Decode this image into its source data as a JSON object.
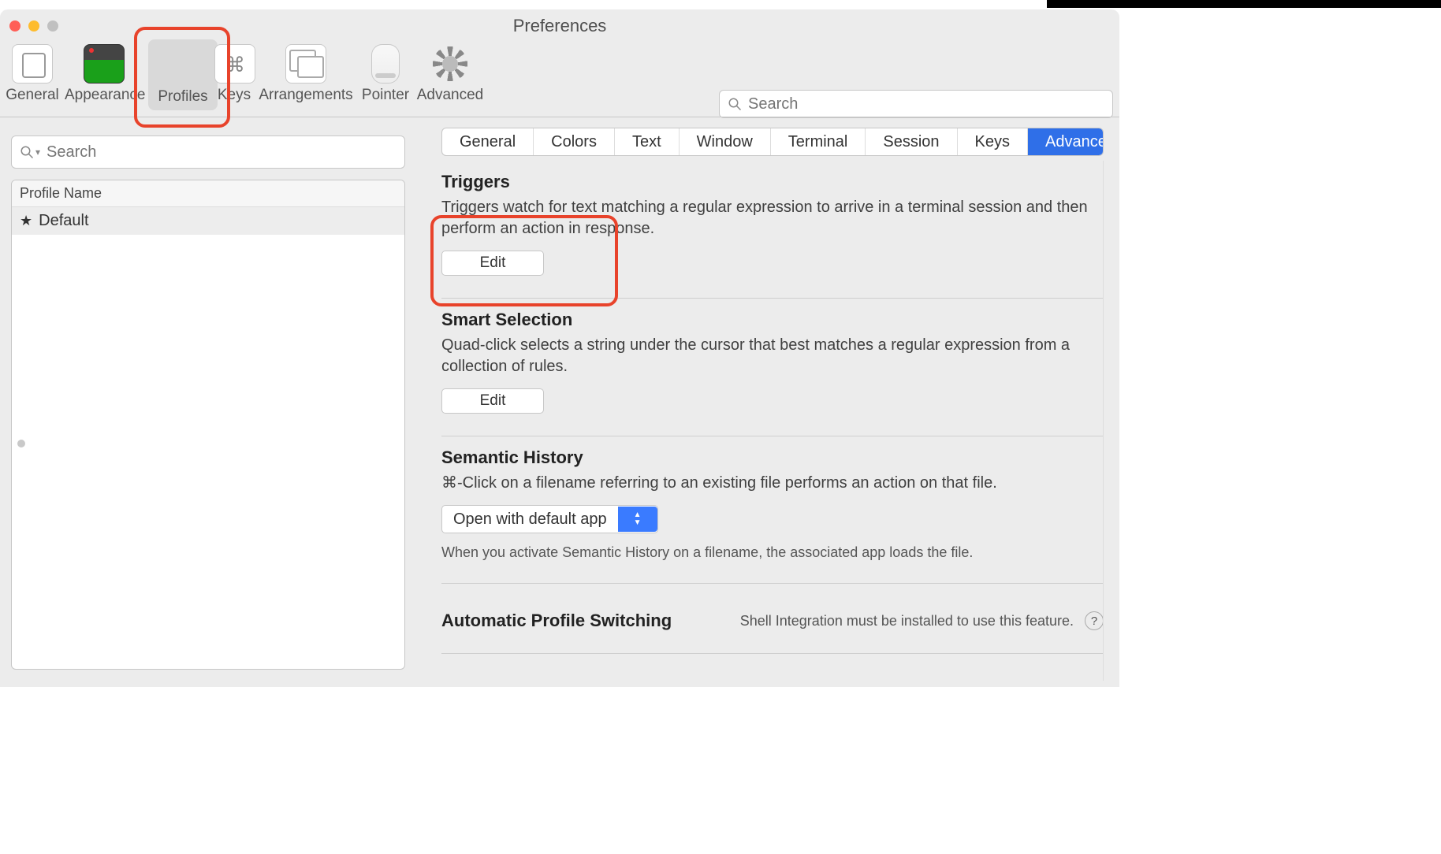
{
  "window": {
    "title": "Preferences"
  },
  "toolbar": {
    "items": [
      {
        "label": "General"
      },
      {
        "label": "Appearance"
      },
      {
        "label": "Profiles"
      },
      {
        "label": "Keys"
      },
      {
        "label": "Arrangements"
      },
      {
        "label": "Pointer"
      },
      {
        "label": "Advanced"
      }
    ],
    "selected_index": 2,
    "search_placeholder": "Search"
  },
  "profiles": {
    "search_placeholder": "Search",
    "column_header": "Profile Name",
    "items": [
      {
        "name": "Default",
        "starred": true
      }
    ],
    "tabs": [
      "General",
      "Colors",
      "Text",
      "Window",
      "Terminal",
      "Session",
      "Keys",
      "Advanced"
    ],
    "tabs_selected_index": 7
  },
  "sections": {
    "triggers": {
      "title": "Triggers",
      "desc": "Triggers watch for text matching a regular expression to arrive in a terminal session and then perform an action in response.",
      "button": "Edit"
    },
    "smart_selection": {
      "title": "Smart Selection",
      "desc": "Quad-click selects a string under the cursor that best matches a regular expression from a collection of rules.",
      "button": "Edit"
    },
    "semantic_history": {
      "title": "Semantic History",
      "desc": "⌘-Click on a filename referring to an existing file performs an action on that file.",
      "select_value": "Open with default app",
      "note": "When you activate Semantic History on a filename, the associated app loads the file."
    },
    "automatic_profile_switching": {
      "title": "Automatic Profile Switching",
      "hint": "Shell Integration must be installed to use this feature."
    }
  }
}
